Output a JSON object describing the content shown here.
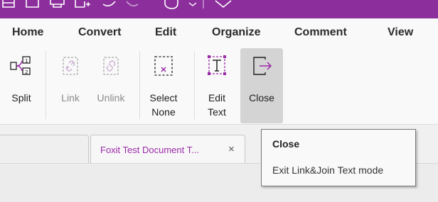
{
  "menu": {
    "tabs": [
      "Home",
      "Convert",
      "Edit",
      "Organize",
      "Comment",
      "View"
    ]
  },
  "ribbon": {
    "split_label": "Split",
    "link_label": "Link",
    "unlink_label": "Unlink",
    "select_none_label_1": "Select",
    "select_none_label_2": "None",
    "edit_text_label_1": "Edit",
    "edit_text_label_2": "Text",
    "close_label": "Close"
  },
  "document_tab": {
    "title": "Foxit Test Document T...",
    "close_glyph": "×"
  },
  "tooltip": {
    "title": "Close",
    "description": "Exit Link&Join Text mode"
  },
  "colors": {
    "brand": "#8c2e9c",
    "tab_text": "#9b2aa8"
  }
}
